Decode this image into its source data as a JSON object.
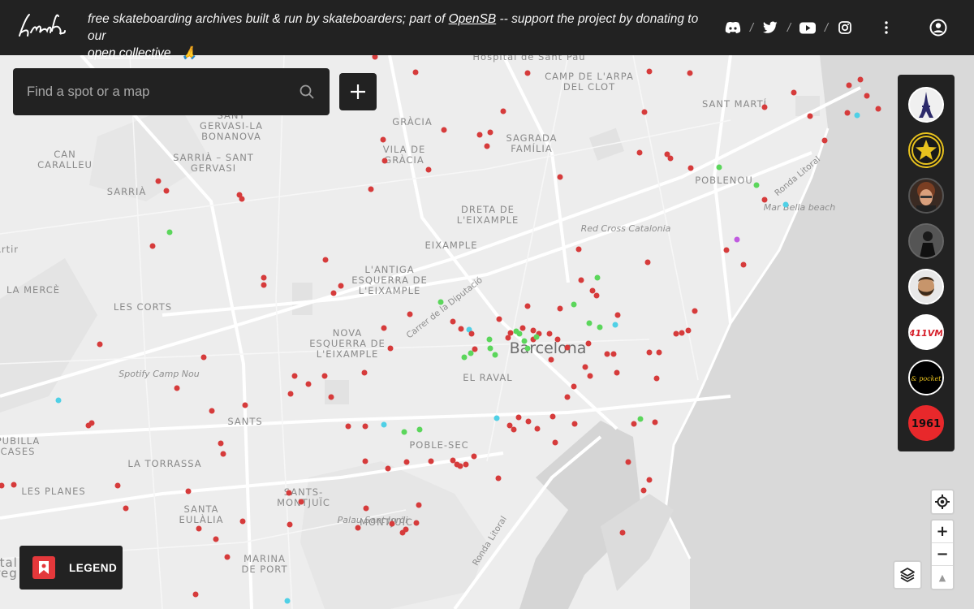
{
  "header": {
    "logo_text": "Kraak",
    "tagline_pre": "free skateboarding archives built & run by skateboarders; part of ",
    "tagline_link1": "OpenSB",
    "tagline_mid": " -- support the project by donating to our ",
    "tagline_link2": "open collective",
    "tagline_emoji": "🙏",
    "socials": [
      "discord-icon",
      "twitter-icon",
      "youtube-icon",
      "instagram-icon"
    ],
    "separator": "/"
  },
  "search": {
    "placeholder": "Find a spot or a map"
  },
  "legend": {
    "label": "LEGEND"
  },
  "maps_panel": {
    "items": [
      {
        "name": "eiffel-tower",
        "label": ""
      },
      {
        "name": "gold-star",
        "label": ""
      },
      {
        "name": "curly-hair-person",
        "label": ""
      },
      {
        "name": "dark-skater",
        "label": ""
      },
      {
        "name": "bearded-person",
        "label": ""
      },
      {
        "name": "brand-logo",
        "label": "411VM"
      },
      {
        "name": "script-logo",
        "label": "& pocket"
      },
      {
        "name": "red-badge",
        "label": "1961"
      }
    ]
  },
  "controls": {
    "zoom_in": "+",
    "zoom_out": "−",
    "north": "▲"
  },
  "colors": {
    "spot_red": "#d63b3b",
    "spot_green": "#5bd65b",
    "spot_cyan": "#4fd0e6",
    "spot_purple": "#c05be0",
    "header_bg": "#222222"
  },
  "map_labels": {
    "districts": [
      "Hospital de Sant Pau",
      "CAMP DE L'ARPA\nDEL CLOT",
      "SANT MARTÍ",
      "GRÀCIA",
      "SAGRADA\nFAMÍLIA",
      "VILA DE\nGRÀCIA",
      "SANT\nGERVASI-LA\nBONANOVA",
      "SARRIÀ – SANT\nGERVASI",
      "CAN\nCARALLEU",
      "SARRIÀ",
      "POBLENOU",
      "DRETA DE\nL'EIXAMPLE",
      "EIXAMPLE",
      "L'ANTIGA\nESQUERRA DE\nL'EIXAMPLE",
      "LA MERCÈ",
      "LES CORTS",
      "NOVA\nESQUERRA DE\nL'EIXAMPLE",
      "EL RAVAL",
      "SANTS",
      "POBLE-SEC",
      "PUBILLA\nCASES",
      "LA TORRASSA",
      "LES PLANES",
      "SANTS-\nMONTJUÏC",
      "SANTA\nEULÀLIA",
      "MONTJUÏC",
      "MARINA\nDE PORT",
      "Artir",
      "Ital\nreg"
    ],
    "pois": [
      "Red Cross Catalonia",
      "Mar Bella beach",
      "Spotify Camp Nou",
      "Palau Sant Jordi"
    ],
    "streets": [
      "Carrer de la Diputació",
      "Ronda Litoral",
      "Ronda Litoral"
    ],
    "city": "Barcelona"
  }
}
